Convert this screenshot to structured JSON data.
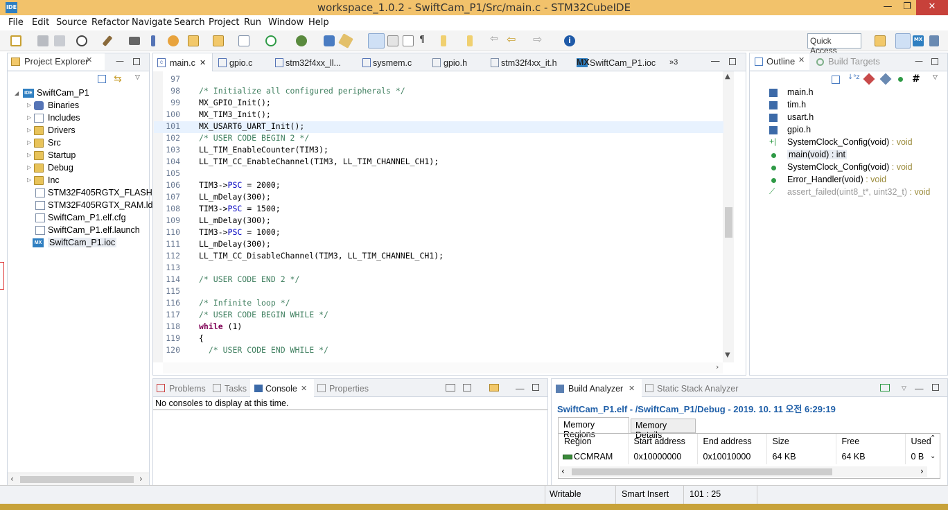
{
  "window": {
    "title": "workspace_1.0.2 - SwiftCam_P1/Src/main.c - STM32CubeIDE",
    "logo": "IDE",
    "minimize": "—",
    "maximize": "❐",
    "close": "✕"
  },
  "menu": [
    "File",
    "Edit",
    "Source",
    "Refactor",
    "Navigate",
    "Search",
    "Project",
    "Run",
    "Window",
    "Help"
  ],
  "toolbar": {
    "quick_access": "Quick Access"
  },
  "project_explorer": {
    "tab": "Project Explorer",
    "project": "SwiftCam_P1",
    "items": [
      "Binaries",
      "Includes",
      "Drivers",
      "Src",
      "Startup",
      "Debug",
      "Inc",
      "STM32F405RGTX_FLASH.ld",
      "STM32F405RGTX_RAM.ld",
      "SwiftCam_P1.elf.cfg",
      "SwiftCam_P1.elf.launch",
      "SwiftCam_P1.ioc"
    ]
  },
  "editor": {
    "tabs": [
      "main.c",
      "gpio.c",
      "stm32f4xx_ll...",
      "sysmem.c",
      "gpio.h",
      "stm32f4xx_it.h",
      "SwiftCam_P1.ioc",
      "»3"
    ],
    "lines": [
      {
        "n": "97",
        "t": ""
      },
      {
        "n": "98",
        "t": "/* Initialize all configured peripherals */",
        "c": "cm"
      },
      {
        "n": "99",
        "t": "MX_GPIO_Init();"
      },
      {
        "n": "100",
        "t": "MX_TIM3_Init();"
      },
      {
        "n": "101",
        "t": "MX_USART6_UART_Init();"
      },
      {
        "n": "102",
        "t": "/* USER CODE BEGIN 2 */",
        "c": "cm"
      },
      {
        "n": "103",
        "t": "LL_TIM_EnableCounter(TIM3);"
      },
      {
        "n": "104",
        "t": "LL_TIM_CC_EnableChannel(TIM3, LL_TIM_CHANNEL_CH1);"
      },
      {
        "n": "105",
        "t": ""
      },
      {
        "n": "106",
        "t": "TIM3->PSC = 2000;"
      },
      {
        "n": "107",
        "t": "LL_mDelay(300);"
      },
      {
        "n": "108",
        "t": "TIM3->PSC = 1500;"
      },
      {
        "n": "109",
        "t": "LL_mDelay(300);"
      },
      {
        "n": "110",
        "t": "TIM3->PSC = 1000;"
      },
      {
        "n": "111",
        "t": "LL_mDelay(300);"
      },
      {
        "n": "112",
        "t": "LL_TIM_CC_DisableChannel(TIM3, LL_TIM_CHANNEL_CH1);"
      },
      {
        "n": "113",
        "t": ""
      },
      {
        "n": "114",
        "t": "/* USER CODE END 2 */",
        "c": "cm"
      },
      {
        "n": "115",
        "t": ""
      },
      {
        "n": "116",
        "t": "/* Infinite loop */",
        "c": "cm"
      },
      {
        "n": "117",
        "t": "/* USER CODE BEGIN WHILE */",
        "c": "cm"
      },
      {
        "n": "118",
        "t": "while (1)"
      },
      {
        "n": "119",
        "t": "{"
      },
      {
        "n": "120",
        "t": "  /* USER CODE END WHILE */",
        "c": "cm"
      }
    ]
  },
  "outline": {
    "tabs": [
      "Outline",
      "Build Targets"
    ],
    "items": [
      {
        "label": "main.h",
        "type": ""
      },
      {
        "label": "tim.h",
        "type": ""
      },
      {
        "label": "usart.h",
        "type": ""
      },
      {
        "label": "gpio.h",
        "type": ""
      },
      {
        "label": "SystemClock_Config(void)",
        "type": " : void"
      },
      {
        "label": "main(void)",
        "type": " : int"
      },
      {
        "label": "SystemClock_Config(void)",
        "type": " : void"
      },
      {
        "label": "Error_Handler(void)",
        "type": " : void"
      },
      {
        "label": "assert_failed(uint8_t*, uint32_t)",
        "type": " : void"
      }
    ]
  },
  "console_panel": {
    "tabs": [
      "Problems",
      "Tasks",
      "Console",
      "Properties"
    ],
    "message": "No consoles to display at this time."
  },
  "build_analyzer": {
    "tabs": [
      "Build Analyzer",
      "Static Stack Analyzer"
    ],
    "heading": "SwiftCam_P1.elf - /SwiftCam_P1/Debug - 2019. 10. 11 오전 6:29:19",
    "subtabs": [
      "Memory Regions",
      "Memory Details"
    ],
    "columns": [
      "Region",
      "Start address",
      "End address",
      "Size",
      "Free",
      "Used"
    ],
    "rows": [
      [
        "CCMRAM",
        "0x10000000",
        "0x10010000",
        "64 KB",
        "64 KB",
        "0 B"
      ]
    ]
  },
  "status": {
    "writable": "Writable",
    "insert": "Smart Insert",
    "position": "101 : 25"
  }
}
